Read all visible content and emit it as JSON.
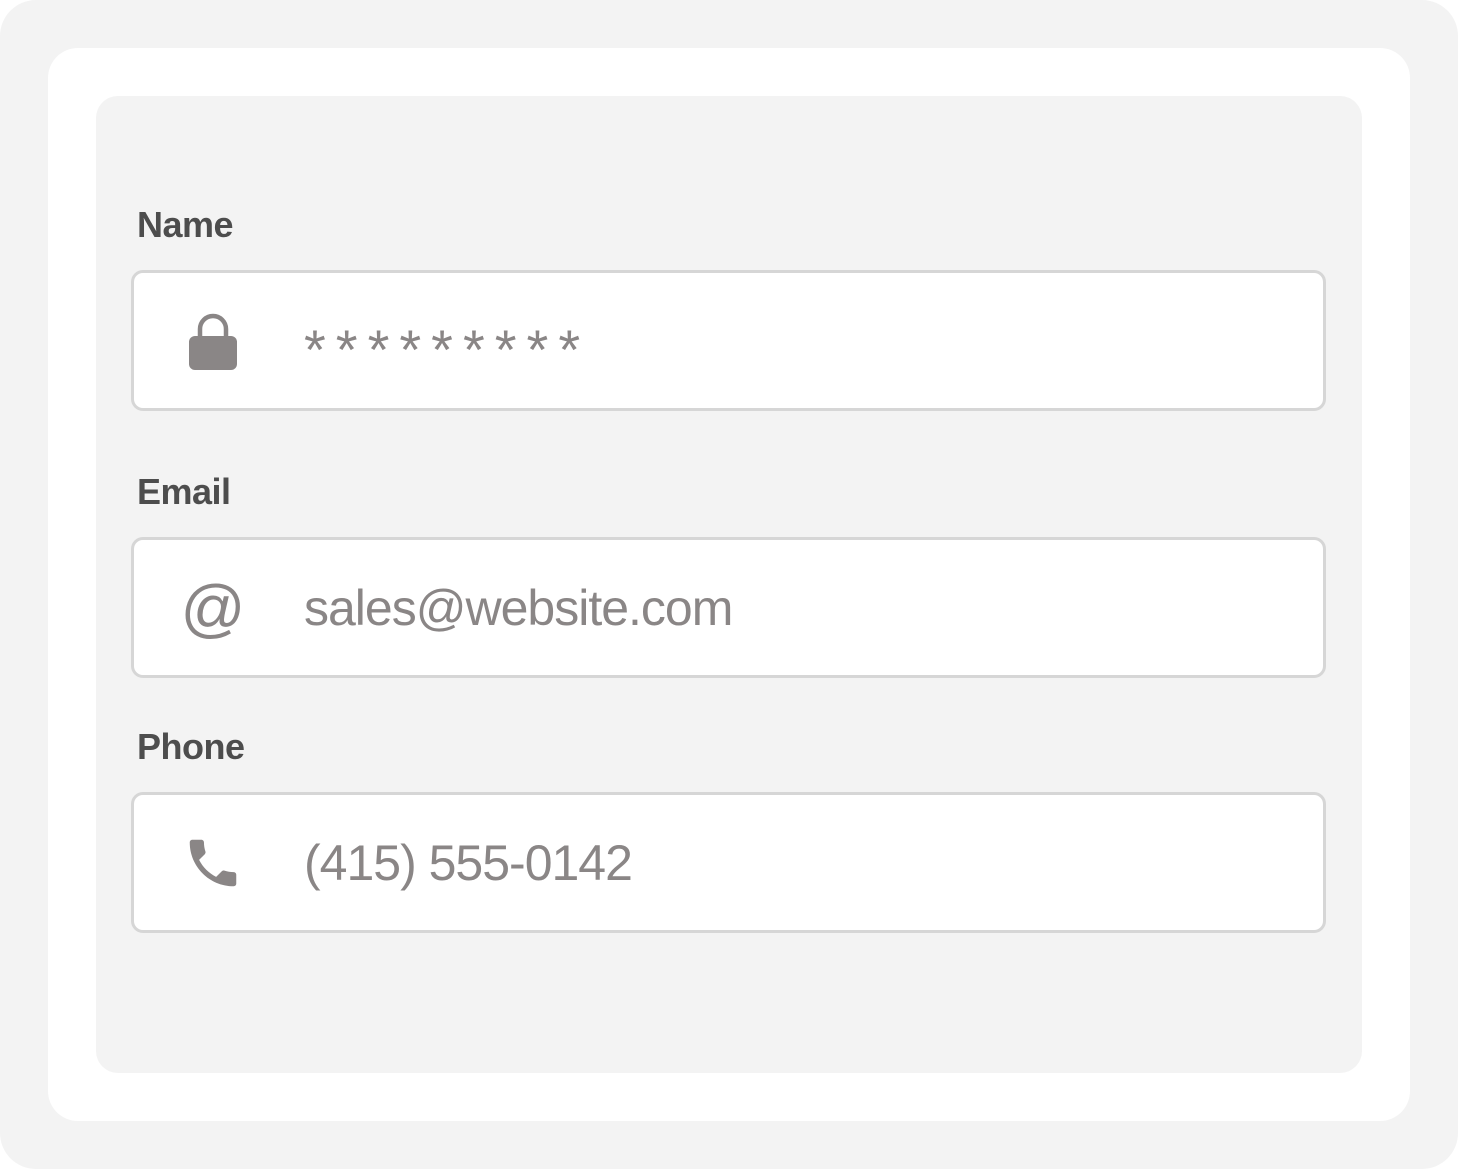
{
  "form": {
    "fields": [
      {
        "label": "Name",
        "icon": "lock-icon",
        "value": "*********"
      },
      {
        "label": "Email",
        "icon": "at-icon",
        "value": "sales@website.com"
      },
      {
        "label": "Phone",
        "icon": "phone-icon",
        "value": "(415) 555-0142"
      }
    ]
  },
  "icons": {
    "at_glyph": "@"
  },
  "colors": {
    "label": "#4d4d4d",
    "value": "#8a8686",
    "border": "#d6d6d6",
    "panel": "#f3f3f3"
  }
}
